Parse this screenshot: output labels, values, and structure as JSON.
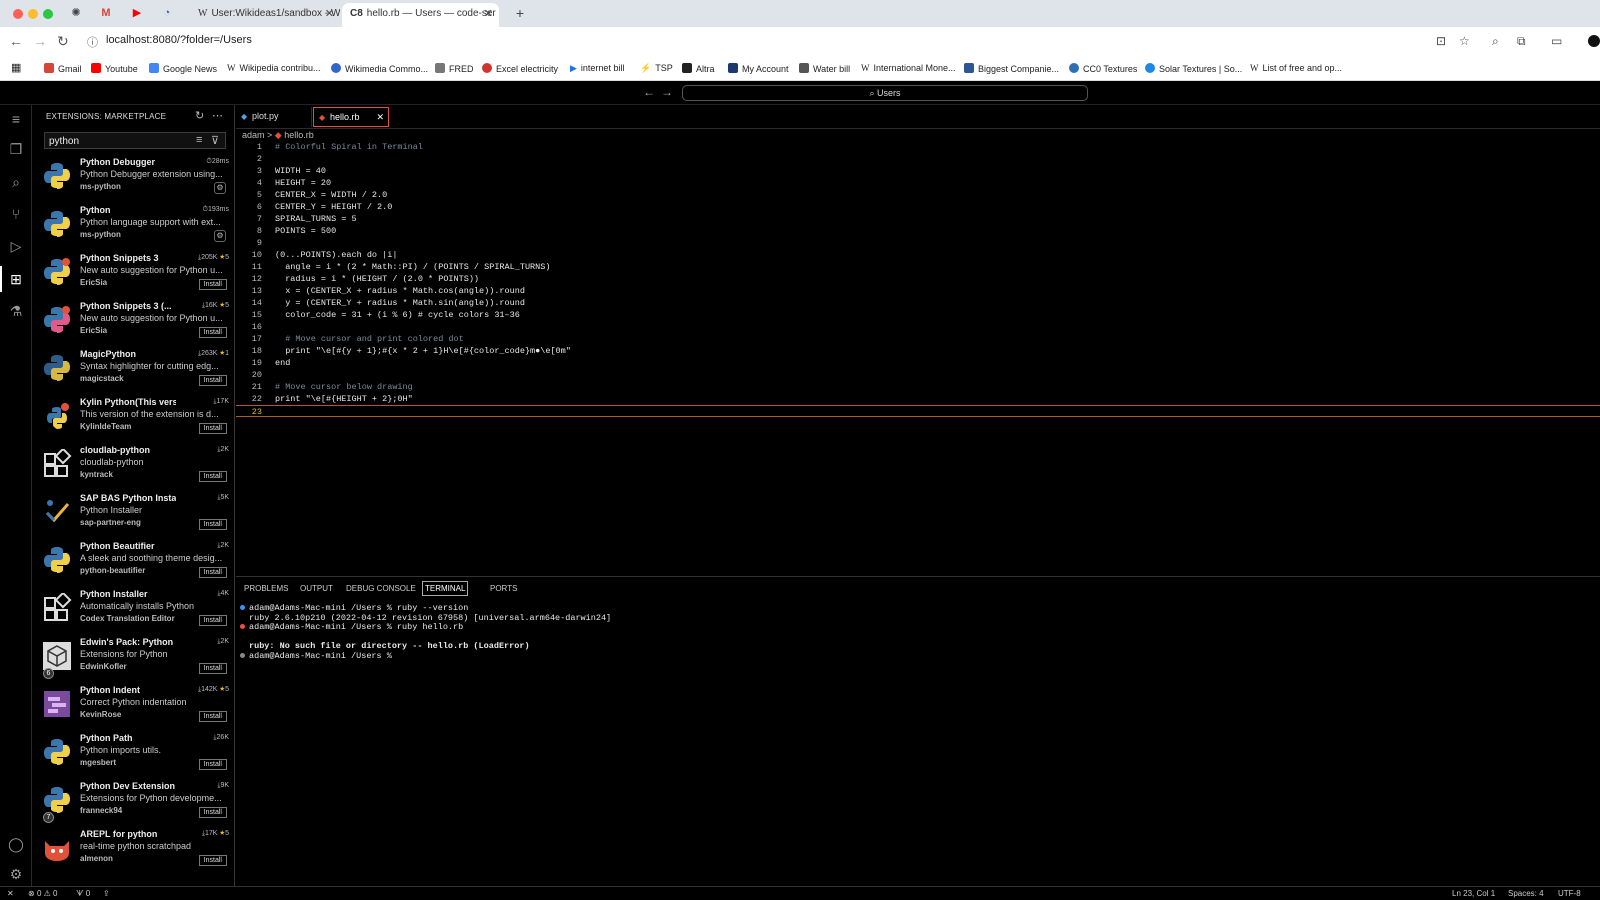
{
  "browser": {
    "tabs": [
      {
        "label": "User:Wikideas1/sandbox - Wi"
      },
      {
        "label": "hello.rb — Users — code-ser"
      }
    ],
    "url": "localhost:8080/?folder=/Users",
    "bookmarks": [
      {
        "label": "Gmail",
        "color": "#d44638"
      },
      {
        "label": "Youtube",
        "color": "#ff0000"
      },
      {
        "label": "Google News",
        "color": "#4285f4"
      },
      {
        "label": "Wikipedia contribu...",
        "color": "#555555"
      },
      {
        "label": "Wikimedia Commo...",
        "color": "#3366cc"
      },
      {
        "label": "FRED",
        "color": "#777777"
      },
      {
        "label": "Excel electricity",
        "color": "#d0342c"
      },
      {
        "label": "internet bill",
        "color": "#1a73e8"
      },
      {
        "label": "TSP",
        "color": "#2a5caa"
      },
      {
        "label": "Altra",
        "color": "#222222"
      },
      {
        "label": "My Account",
        "color": "#1b3a6b"
      },
      {
        "label": "Water bill",
        "color": "#555555"
      },
      {
        "label": "International Mone...",
        "color": "#555555"
      },
      {
        "label": "Biggest Companie...",
        "color": "#2b5797"
      },
      {
        "label": "CC0 Textures",
        "color": "#2f6fb3"
      },
      {
        "label": "Solar Textures | So...",
        "color": "#1e88e5"
      },
      {
        "label": "List of free and op...",
        "color": "#555555"
      }
    ]
  },
  "vscode": {
    "command_center": "Users",
    "sidebar": {
      "title": "EXTENSIONS: MARKETPLACE",
      "search_value": "python",
      "extensions": [
        {
          "name": "Python Debugger",
          "meta": "28ms",
          "desc": "Python Debugger extension using...",
          "publisher": "ms-python",
          "action": "gear",
          "icon": "python"
        },
        {
          "name": "Python",
          "meta": "193ms",
          "desc": "Python language support with ext...",
          "publisher": "ms-python",
          "action": "gear",
          "icon": "python"
        },
        {
          "name": "Python Snippets 3",
          "meta": "205K",
          "stars": "5",
          "desc": "New auto suggestion for Python u...",
          "publisher": "EricSia",
          "action": "Install",
          "icon": "python-badge"
        },
        {
          "name": "Python Snippets 3 (...",
          "meta": "16K",
          "stars": "5",
          "desc": "New auto suggestion for Python u...",
          "publisher": "EricSia",
          "action": "Install",
          "icon": "python-pink"
        },
        {
          "name": "MagicPython",
          "meta": "263K",
          "stars": "1",
          "desc": "Syntax highlighter for cutting edg...",
          "publisher": "magicstack",
          "action": "Install",
          "icon": "python-dark"
        },
        {
          "name": "Kylin Python(This versio...",
          "meta": "17K",
          "desc": "This version of the extension is d...",
          "publisher": "KylinIdeTeam",
          "action": "Install",
          "icon": "python-k"
        },
        {
          "name": "cloudlab-python",
          "meta": "2K",
          "desc": "cloudlab-python",
          "publisher": "kyntrack",
          "action": "Install",
          "icon": "blocks"
        },
        {
          "name": "SAP BAS Python Installer",
          "meta": "5K",
          "desc": "Python Installer",
          "publisher": "sap-partner-eng",
          "action": "Install",
          "icon": "sap"
        },
        {
          "name": "Python Beautifier",
          "meta": "2K",
          "desc": "A sleek and soothing theme desig...",
          "publisher": "python-beautifier",
          "action": "Install",
          "icon": "python"
        },
        {
          "name": "Python Installer",
          "meta": "4K",
          "desc": "Automatically installs Python",
          "publisher": "Codex Translation Editor",
          "action": "Install",
          "icon": "blocks"
        },
        {
          "name": "Edwin's Pack: Python",
          "meta": "2K",
          "desc": "Extensions for Python",
          "publisher": "EdwinKofler",
          "action": "Install",
          "icon": "pack",
          "badge": "6"
        },
        {
          "name": "Python Indent",
          "meta": "142K",
          "stars": "5",
          "desc": "Correct Python indentation",
          "publisher": "KevinRose",
          "action": "Install",
          "icon": "indent"
        },
        {
          "name": "Python Path",
          "meta": "26K",
          "desc": "Python imports utils.",
          "publisher": "mgesbert",
          "action": "Install",
          "icon": "python"
        },
        {
          "name": "Python Dev Extension Pa...",
          "meta": "9K",
          "desc": "Extensions for Python developme...",
          "publisher": "franneck94",
          "action": "Install",
          "icon": "python",
          "badge": "7"
        },
        {
          "name": "AREPL for python",
          "meta": "17K",
          "stars": "5",
          "desc": "real-time python scratchpad",
          "publisher": "almenon",
          "action": "Install",
          "icon": "cat"
        }
      ]
    },
    "editor_tabs": [
      {
        "label": "plot.py"
      },
      {
        "label": "hello.rb"
      }
    ],
    "breadcrumb": {
      "folder": "adam",
      "file": "hello.rb"
    },
    "code_lines": [
      {
        "n": "1",
        "text": "# Colorful Spiral in Terminal",
        "kind": "comment"
      },
      {
        "n": "2",
        "text": ""
      },
      {
        "n": "3",
        "text": "WIDTH = 40"
      },
      {
        "n": "4",
        "text": "HEIGHT = 20"
      },
      {
        "n": "5",
        "text": "CENTER_X = WIDTH / 2.0"
      },
      {
        "n": "6",
        "text": "CENTER_Y = HEIGHT / 2.0"
      },
      {
        "n": "7",
        "text": "SPIRAL_TURNS = 5"
      },
      {
        "n": "8",
        "text": "POINTS = 500"
      },
      {
        "n": "9",
        "text": ""
      },
      {
        "n": "10",
        "text": "(0...POINTS).each do |i|"
      },
      {
        "n": "11",
        "text": "  angle = i * (2 * Math::PI) / (POINTS / SPIRAL_TURNS)"
      },
      {
        "n": "12",
        "text": "  radius = i * (HEIGHT / (2.0 * POINTS))"
      },
      {
        "n": "13",
        "text": "  x = (CENTER_X + radius * Math.cos(angle)).round"
      },
      {
        "n": "14",
        "text": "  y = (CENTER_Y + radius * Math.sin(angle)).round"
      },
      {
        "n": "15",
        "text": "  color_code = 31 + (i % 6) # cycle colors 31–36"
      },
      {
        "n": "16",
        "text": ""
      },
      {
        "n": "17",
        "text": "  # Move cursor and print colored dot",
        "kind": "comment"
      },
      {
        "n": "18",
        "text": "  print \"\\e[#{y + 1};#{x * 2 + 1}H\\e[#{color_code}m●\\e[0m\""
      },
      {
        "n": "19",
        "text": "end"
      },
      {
        "n": "20",
        "text": ""
      },
      {
        "n": "21",
        "text": "# Move cursor below drawing",
        "kind": "comment"
      },
      {
        "n": "22",
        "text": "print \"\\e[#{HEIGHT + 2};0H\""
      },
      {
        "n": "23",
        "text": "",
        "current": true
      }
    ],
    "panel_tabs": [
      "PROBLEMS",
      "OUTPUT",
      "DEBUG CONSOLE",
      "TERMINAL",
      "PORTS"
    ],
    "terminal_lines": [
      {
        "text": "adam@Adams-Mac-mini /Users % ruby --version",
        "dot": "#3794ff"
      },
      {
        "text": "ruby 2.6.10p210 (2022-04-12 revision 67958) [universal.arm64e-darwin24]"
      },
      {
        "text": "adam@Adams-Mac-mini /Users % ruby hello.rb",
        "dot": "#f14c4c"
      },
      {
        "text": ""
      },
      {
        "text": "ruby: No such file or directory -- hello.rb (LoadError)",
        "bold": true
      },
      {
        "text": "adam@Adams-Mac-mini /Users % ",
        "dot": "#888888"
      }
    ],
    "status": {
      "errors": "0",
      "warnings": "0",
      "ports": "0",
      "position": "Ln 23, Col 1",
      "spaces": "Spaces: 4",
      "encoding": "UTF-8"
    }
  }
}
